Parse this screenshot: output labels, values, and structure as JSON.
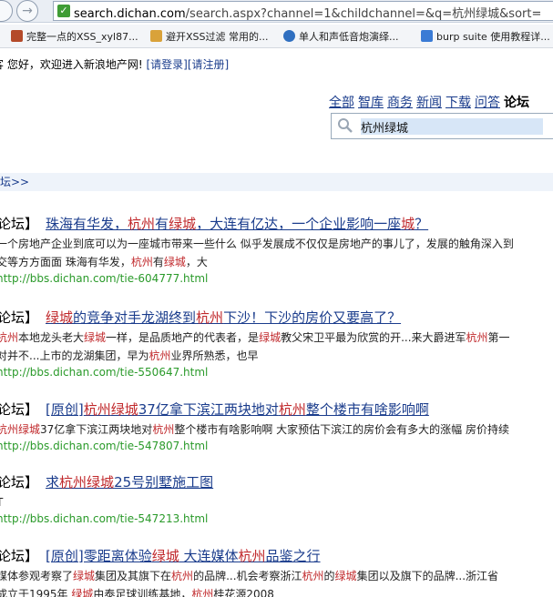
{
  "browser": {
    "url_host": "search.dichan.com",
    "url_rest": "/search.aspx?channel=1&childchannel=&q=杭州绿城&sort=",
    "bookmarks": [
      {
        "label": "完整一点的XSS_xyl87...",
        "color": "#b44a2a"
      },
      {
        "label": "避开XSS过滤 常用的...",
        "color": "#3a7bd5"
      },
      {
        "label": "单人和声低音炮演绎...",
        "color": "#2f6fc0"
      },
      {
        "label": "burp suite 使用教程详...",
        "color": "#3a7bd5"
      }
    ]
  },
  "header": {
    "welcome_prefix": "客  您好，欢迎进入新浪地产网!",
    "login": "[请登录]",
    "register": "[请注册]"
  },
  "nav": {
    "items": [
      "全部",
      "智库",
      "商务",
      "新闻",
      "下载",
      "问答"
    ],
    "active": "论坛"
  },
  "search": {
    "value": "杭州绿城"
  },
  "breadcrumb": "坛>>",
  "results": [
    {
      "forum": "论坛】",
      "title_parts": [
        [
          "珠海有华发，",
          0
        ],
        [
          "杭州",
          1
        ],
        [
          "有",
          0
        ],
        [
          "绿城",
          1
        ],
        [
          "，大连有亿达，一个企业影响一座",
          0
        ],
        [
          "城",
          1
        ],
        [
          "？",
          0
        ]
      ],
      "line1": [
        [
          "一个房地产企业到底可以为一座城市带来一些什么  似乎发展成不仅仅是房地产的事儿了，发展的触角深入到",
          0
        ]
      ],
      "line2": [
        [
          "交等方方面面  珠海有华发，",
          0
        ],
        [
          "杭州",
          1
        ],
        [
          "有",
          0
        ],
        [
          "绿城",
          1
        ],
        [
          "，大",
          0
        ]
      ],
      "url": "http://bbs.dichan.com/tie-604777.html"
    },
    {
      "forum": "论坛】",
      "title_parts": [
        [
          "绿城",
          1
        ],
        [
          "的竞争对手龙湖终到",
          0
        ],
        [
          "杭州",
          1
        ],
        [
          "下沙！下沙的房价又要高了？",
          0
        ]
      ],
      "line1": [
        [
          "杭州",
          1
        ],
        [
          "本地龙头老大",
          0
        ],
        [
          "绿城",
          1
        ],
        [
          "一样，是品质地产的代表者，是",
          0
        ],
        [
          "绿城",
          1
        ],
        [
          "教父宋卫平最为欣赏的开...来大爵进军",
          0
        ],
        [
          "杭州",
          1
        ],
        [
          "第一",
          0
        ]
      ],
      "line2": [
        [
          "对并不...上市的龙湖集团，早为",
          0
        ],
        [
          "杭州",
          1
        ],
        [
          "业界所熟悉，也早",
          0
        ]
      ],
      "url": "http://bbs.dichan.com/tie-550647.html"
    },
    {
      "forum": "论坛】",
      "title_parts": [
        [
          "[原创]",
          0
        ],
        [
          "杭州",
          1
        ],
        [
          "绿城",
          1
        ],
        [
          "37亿拿下滨江两块地对",
          0
        ],
        [
          "杭州",
          1
        ],
        [
          "整个楼市有啥影响啊",
          0
        ]
      ],
      "line1": [
        [
          "杭州",
          1
        ],
        [
          "绿城",
          1
        ],
        [
          "37亿拿下滨江两块地对",
          0
        ],
        [
          "杭州",
          1
        ],
        [
          "整个楼市有啥影响啊  大家预估下滨江的房价会有多大的涨幅  房价持续",
          0
        ]
      ],
      "line2": [],
      "url": "http://bbs.dichan.com/tie-547807.html"
    },
    {
      "forum": "论坛】",
      "title_parts": [
        [
          "求",
          0
        ],
        [
          "杭州",
          1
        ],
        [
          "绿城",
          1
        ],
        [
          "25号别墅施工图",
          0
        ]
      ],
      "line1": [
        [
          "T",
          0
        ]
      ],
      "line2": [],
      "url": "http://bbs.dichan.com/tie-547213.html"
    },
    {
      "forum": "论坛】",
      "title_parts": [
        [
          "[原创]零距离体验",
          0
        ],
        [
          "绿城",
          1
        ],
        [
          "  大连媒体",
          0
        ],
        [
          "杭州",
          1
        ],
        [
          "品鉴之行",
          0
        ]
      ],
      "line1": [
        [
          "媒体参观考察了",
          0
        ],
        [
          "绿城",
          1
        ],
        [
          "集团及其旗下在",
          0
        ],
        [
          "杭州",
          1
        ],
        [
          "的品牌...机会考察浙江",
          0
        ],
        [
          "杭州",
          1
        ],
        [
          "的",
          0
        ],
        [
          "绿城",
          1
        ],
        [
          "集团以及旗下的品牌...浙江省",
          0
        ]
      ],
      "line2": [
        [
          "成立于1995年     ",
          0
        ],
        [
          "绿城",
          1
        ],
        [
          "由泰足球训练基地，",
          0
        ],
        [
          "杭州",
          1
        ],
        [
          "桂花源2008",
          0
        ]
      ],
      "url": ""
    }
  ]
}
